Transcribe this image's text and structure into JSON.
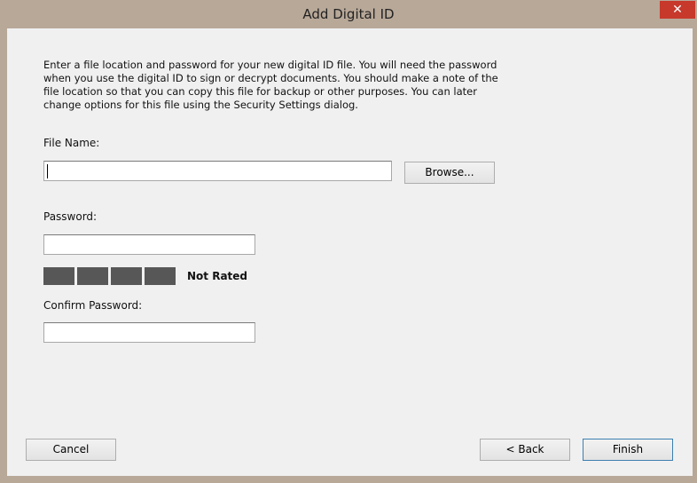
{
  "window": {
    "title": "Add Digital ID",
    "close_glyph": "✕"
  },
  "intro_text": "Enter a file location and password for your new digital ID file. You will need the password when you use the digital ID to sign or decrypt documents. You should make a note of the file location so that you can copy this file for backup or other purposes. You can later change options for this file using the Security Settings dialog.",
  "file_name": {
    "label": "File Name:",
    "value": "",
    "browse_label": "Browse..."
  },
  "password": {
    "label": "Password:",
    "value": "",
    "strength_rating": "Not Rated",
    "strength_segments_filled": 0,
    "strength_segments_total": 4
  },
  "confirm_password": {
    "label": "Confirm Password:",
    "value": ""
  },
  "footer": {
    "cancel_label": "Cancel",
    "back_label": "< Back",
    "finish_label": "Finish"
  }
}
